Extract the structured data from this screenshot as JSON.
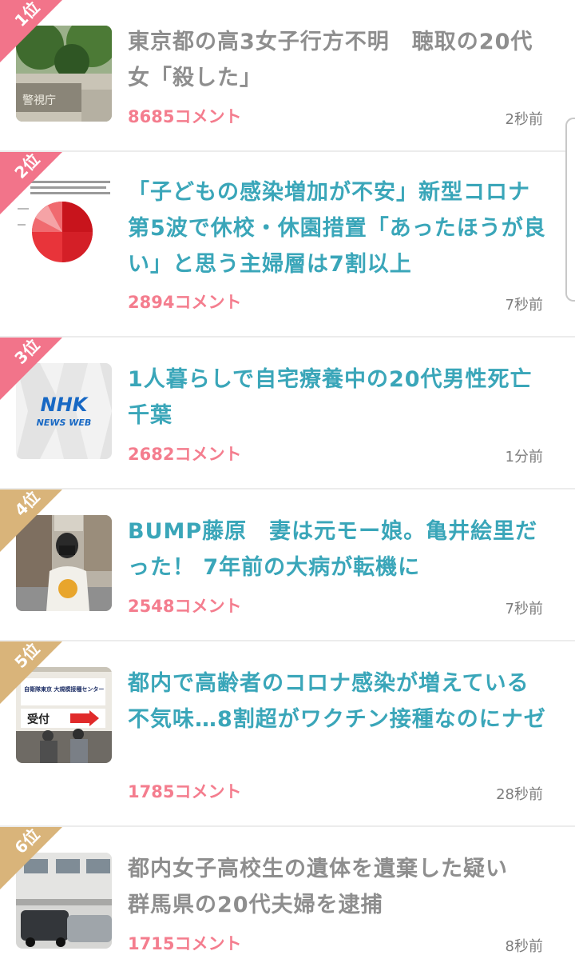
{
  "ranking": [
    {
      "rank_label": "1位",
      "ribbon_color": "#f2748a",
      "title": "東京都の高3女子行方不明　聴取の20代女「殺した」",
      "comments": "8685コメント",
      "time": "2秒前",
      "read": true,
      "thumb_text": "警視庁"
    },
    {
      "rank_label": "2位",
      "ribbon_color": "#f2748a",
      "title": "「子どもの感染増加が不安」新型コロナ第5波で休校・休園措置「あったほうが良い」と思う主婦層は7割以上",
      "comments": "2894コメント",
      "time": "7秒前",
      "read": false
    },
    {
      "rank_label": "3位",
      "ribbon_color": "#f2748a",
      "title": "1人暮らしで自宅療養中の20代男性死亡　千葉",
      "comments": "2682コメント",
      "time": "1分前",
      "read": false,
      "thumb_text": "NHK",
      "thumb_subtext": "NEWS WEB"
    },
    {
      "rank_label": "4位",
      "ribbon_color": "#d9b47a",
      "title": "BUMP藤原　妻は元モー娘。亀井絵里だった！ 7年前の大病が転機に",
      "comments": "2548コメント",
      "time": "7秒前",
      "read": false
    },
    {
      "rank_label": "5位",
      "ribbon_color": "#d9b47a",
      "title": "都内で高齢者のコロナ感染が増えている不気味…8割超がワクチン接種なのにナゼ",
      "comments": "1785コメント",
      "time": "28秒前",
      "read": false,
      "thumb_text": "自衛隊東京 大規模接種センター",
      "thumb_subtext": "受付"
    },
    {
      "rank_label": "6位",
      "ribbon_color": "#d9b47a",
      "title": "都内女子高校生の遺体を遺棄した疑い　群馬県の20代夫婦を逮捕",
      "comments": "1715コメント",
      "time": "8秒前",
      "read": true
    }
  ]
}
